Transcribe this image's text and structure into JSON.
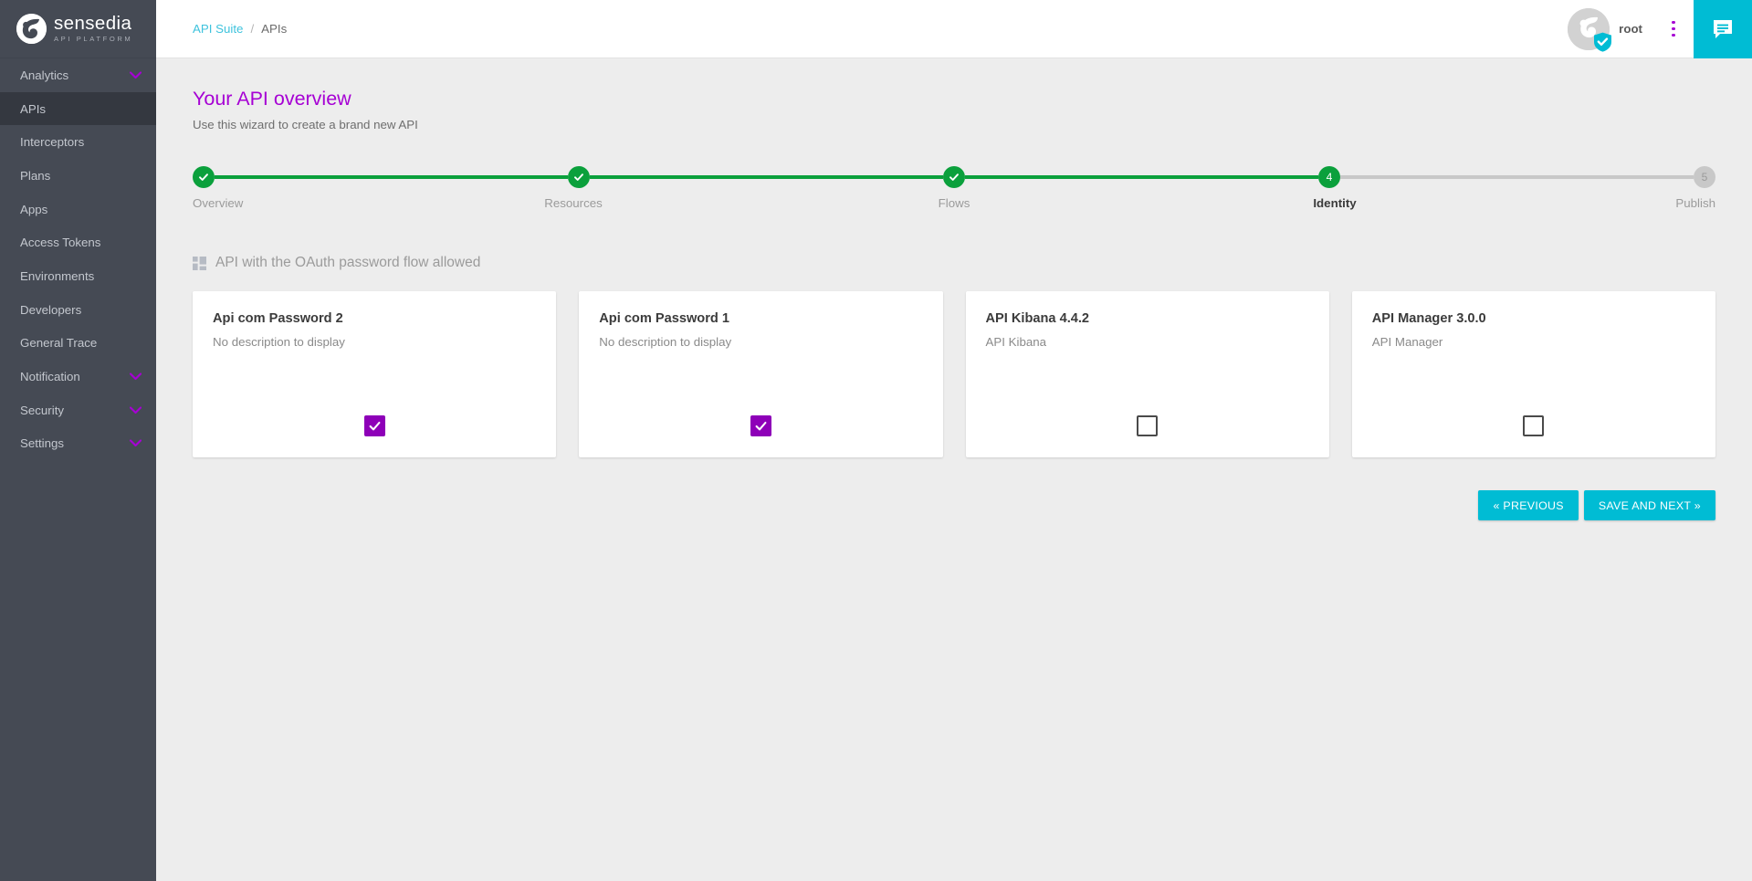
{
  "brand": {
    "name": "sensedia",
    "tagline": "API PLATFORM",
    "logo_icon": "sensedia-swirl-logo"
  },
  "colors": {
    "sidebar_bg": "#454a54",
    "sidebar_active": "#343840",
    "accent_purple": "#a600d4",
    "accent_cyan": "#00bcd4",
    "step_green": "#0ba03c",
    "step_gray": "#c8c8c8",
    "checkbox_purple": "#8e00b8",
    "page_bg": "#ededed"
  },
  "sidebar": {
    "items": [
      {
        "label": "Analytics",
        "active": false,
        "expandable": true
      },
      {
        "label": "APIs",
        "active": true,
        "expandable": false
      },
      {
        "label": "Interceptors",
        "active": false,
        "expandable": false
      },
      {
        "label": "Plans",
        "active": false,
        "expandable": false
      },
      {
        "label": "Apps",
        "active": false,
        "expandable": false
      },
      {
        "label": "Access Tokens",
        "active": false,
        "expandable": false
      },
      {
        "label": "Environments",
        "active": false,
        "expandable": false
      },
      {
        "label": "Developers",
        "active": false,
        "expandable": false
      },
      {
        "label": "General Trace",
        "active": false,
        "expandable": false
      },
      {
        "label": "Notification",
        "active": false,
        "expandable": true
      },
      {
        "label": "Security",
        "active": false,
        "expandable": true
      },
      {
        "label": "Settings",
        "active": false,
        "expandable": true
      }
    ]
  },
  "topbar": {
    "breadcrumb": {
      "root": "API Suite",
      "separator": "/",
      "current": "APIs"
    },
    "user": {
      "name": "root",
      "avatar_icon": "user-avatar",
      "badge_icon": "shield-check-icon"
    },
    "kebab_icon": "more-vertical-icon",
    "chat_icon": "chat-bubble-icon"
  },
  "page": {
    "title": "Your API overview",
    "subtitle": "Use this wizard to create a brand new API"
  },
  "stepper": {
    "current_index": 3,
    "steps": [
      {
        "label": "Overview",
        "number": "1",
        "state": "done"
      },
      {
        "label": "Resources",
        "number": "2",
        "state": "done"
      },
      {
        "label": "Flows",
        "number": "3",
        "state": "done"
      },
      {
        "label": "Identity",
        "number": "4",
        "state": "current"
      },
      {
        "label": "Publish",
        "number": "5",
        "state": "todo"
      }
    ]
  },
  "section": {
    "icon": "dashboard-grid-icon",
    "title": "API with the OAuth password flow allowed"
  },
  "cards": [
    {
      "title": "Api com Password 2",
      "description": "No description to display",
      "checked": true
    },
    {
      "title": "Api com Password 1",
      "description": "No description to display",
      "checked": true
    },
    {
      "title": "API Kibana 4.4.2",
      "description": "API Kibana",
      "checked": false
    },
    {
      "title": "API Manager 3.0.0",
      "description": "API Manager",
      "checked": false
    }
  ],
  "actions": {
    "previous_label": "« PREVIOUS",
    "next_label": "SAVE AND NEXT »"
  }
}
